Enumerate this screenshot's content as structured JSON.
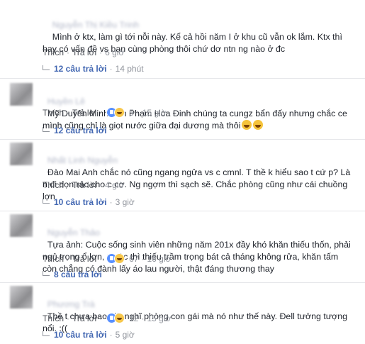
{
  "comments": [
    {
      "name_blurred": "Nguyễn Thị Kiều Trinh",
      "text": "Mình ở ktx, làm gì tới nỗi này. Kể cả hồi năm I ở khu cũ vẫn ok lắm. Ktx thì hay có vấn đề vs bạn cùng phòng thôi chứ dơ ntn ng nào ở đc",
      "like": "Thích",
      "reply": "Trả lời",
      "time": "6 giờ",
      "reaction_count": "",
      "replies_label": "12 câu trả lời",
      "replies_time": "14 phút"
    },
    {
      "name_blurred": "Huyền Lê",
      "text": "Mỹ Duyên Minh Ánh Phạm Hoa Đinh chúng ta cungz bẩn đấy nhưng chắc ce mình cũng chỉ là giọt nước giữa đại dương mà thôi",
      "like": "Thích",
      "reply": "Trả lời",
      "time": "15 giờ",
      "reaction_count": "5",
      "replies_label": "12 câu trả lời",
      "replies_time": ""
    },
    {
      "name_blurred": "Nhất Linh Nguyễn",
      "text": "Đào Mai Anh chắc nó cũng ngang ngửa vs c cmnl. T thề k hiểu sao t cứ p? Là n đi dọn rác cho c cơ. Ng ngợm thì sạch sẽ. Chắc phòng cũng như cái chuồng lợn",
      "like": "Thích",
      "reply": "Trả lời",
      "time": "4 giờ",
      "reaction_count": "",
      "replies_label": "10 câu trả lời",
      "replies_time": "3 giờ"
    },
    {
      "name_blurred": "Nguyễn Thảo",
      "text": "Tựa ảnh: Cuộc sống sinh viên những năm 201x đầy khó khăn thiếu thốn, phải ngủ trọng ổ lợn, nước thì thiếu trầm trọng bát cả tháng không rửa, khăn tấm còn chẳng có đành lấy áo lau người, thật đáng thương thay",
      "like": "Thích",
      "reply": "Trả lời",
      "time": "16 giờ",
      "reaction_count": "67",
      "replies_label": "8 câu trả lời",
      "replies_time": ""
    },
    {
      "name_blurred": "Phương Trà",
      "text": "Thề t chưa bao giờ nghĩ phòng con gái mà nó như thế này. Đell tưởng tượng nổi. :((",
      "like": "Thích",
      "reply": "Trả lời",
      "time": "15 giờ",
      "reaction_count": "12",
      "replies_label": "10 câu trả lời",
      "replies_time": "5 giờ"
    }
  ],
  "colors": {
    "link": "#4267b2",
    "meta": "#90949c",
    "text": "#1d2129"
  },
  "icons": [
    "avatar",
    "reply-arrow-icon",
    "like-reaction-icon",
    "haha-reaction-icon",
    "laughing-emoji-icon"
  ]
}
